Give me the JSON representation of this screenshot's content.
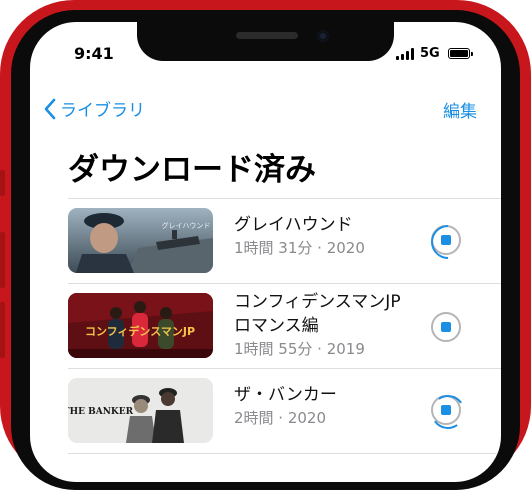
{
  "status_bar": {
    "time": "9:41",
    "network": "5G"
  },
  "nav": {
    "back_label": "ライブラリ",
    "edit_label": "編集"
  },
  "page": {
    "title": "ダウンロード済み"
  },
  "downloads": [
    {
      "title_lines": [
        "グレイハウンド"
      ],
      "meta": "1時間 31分 · 2020",
      "thumb_text": "グレイハウンド"
    },
    {
      "title_lines": [
        "コンフィデンスマンJP",
        "ロマンス編"
      ],
      "meta": "1時間 55分 · 2019",
      "thumb_text": "コンフィデンスマンJP"
    },
    {
      "title_lines": [
        "ザ・バンカー"
      ],
      "meta": "2時間 · 2020",
      "thumb_text": "THE BANKER"
    }
  ],
  "colors": {
    "accent": "#1a8fe3",
    "phone_frame": "#c8171c",
    "subtitle": "#8a8a8e"
  }
}
